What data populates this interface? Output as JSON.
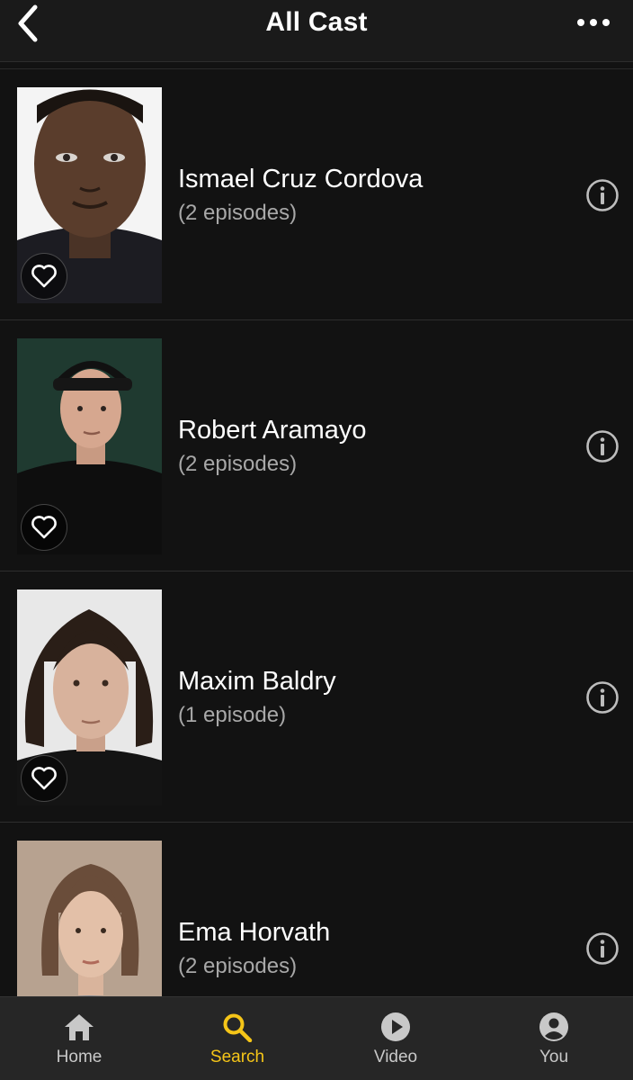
{
  "header": {
    "title": "All Cast"
  },
  "cast": [
    {
      "name": "Ismael Cruz Cordova",
      "episodes": "(2 episodes)"
    },
    {
      "name": "Robert Aramayo",
      "episodes": "(2 episodes)"
    },
    {
      "name": "Maxim Baldry",
      "episodes": "(1 episode)"
    },
    {
      "name": "Ema Horvath",
      "episodes": "(2 episodes)"
    }
  ],
  "tabs": [
    {
      "label": "Home",
      "icon": "home-icon"
    },
    {
      "label": "Search",
      "icon": "search-icon",
      "active": true
    },
    {
      "label": "Video",
      "icon": "play-icon"
    },
    {
      "label": "You",
      "icon": "person-icon"
    }
  ],
  "colors": {
    "background": "#121212",
    "accent": "#f5c518",
    "secondary_text": "#a8a8a8"
  }
}
